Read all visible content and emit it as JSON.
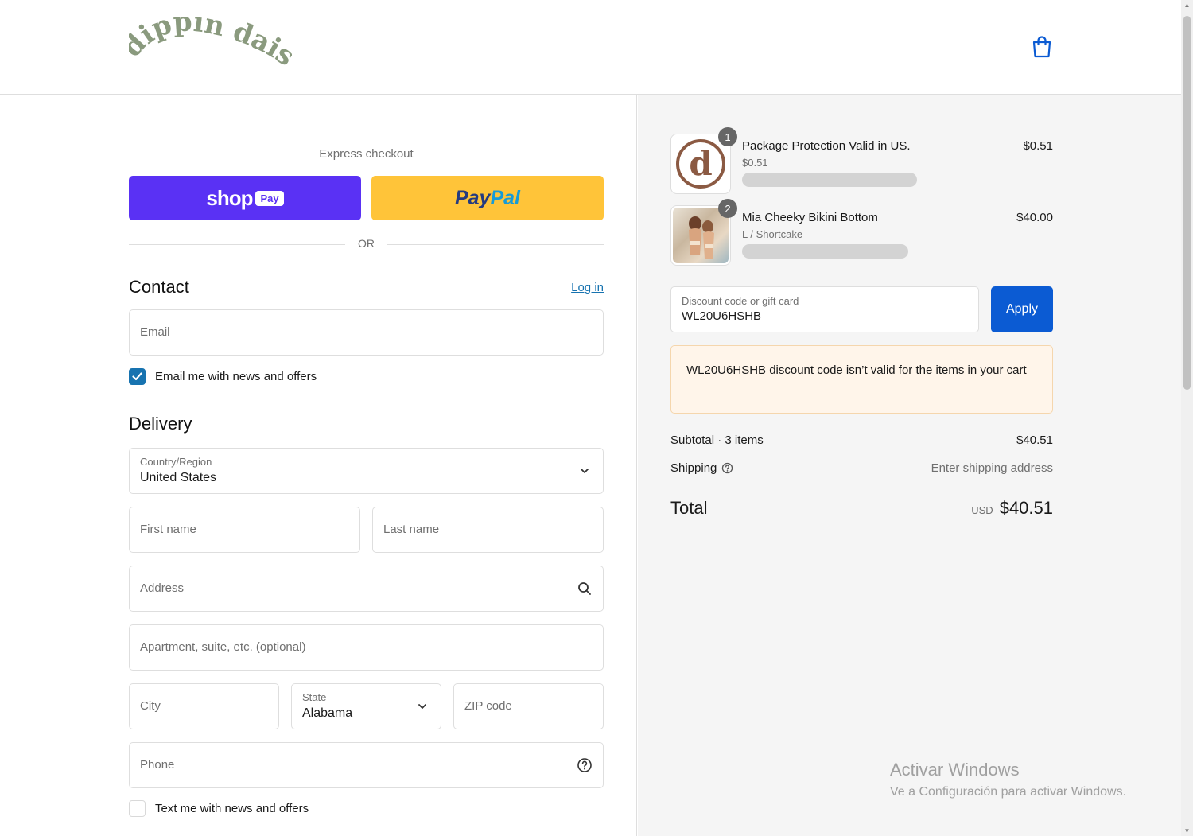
{
  "brand": {
    "logo_text": "dippin daisys"
  },
  "express": {
    "label": "Express checkout",
    "shop_word": "shop",
    "shop_badge": "Pay",
    "paypal_part1": "Pay",
    "paypal_part2": "Pal",
    "or_text": "OR"
  },
  "contact": {
    "title": "Contact",
    "login_link": "Log in",
    "email_placeholder": "Email",
    "newsletter_label": "Email me with news and offers",
    "newsletter_checked": true
  },
  "delivery": {
    "title": "Delivery",
    "country_label": "Country/Region",
    "country_value": "United States",
    "first_name_placeholder": "First name",
    "last_name_placeholder": "Last name",
    "address_placeholder": "Address",
    "apartment_placeholder": "Apartment, suite, etc. (optional)",
    "city_placeholder": "City",
    "state_label": "State",
    "state_value": "Alabama",
    "zip_placeholder": "ZIP code",
    "phone_placeholder": "Phone",
    "sms_label": "Text me with news and offers",
    "sms_checked": false
  },
  "cart": {
    "items": [
      {
        "qty": "1",
        "name": "Package Protection Valid in US.",
        "sub": "$0.51",
        "price": "$0.51",
        "thumb": "d"
      },
      {
        "qty": "2",
        "name": "Mia Cheeky Bikini Bottom",
        "sub": "L / Shortcake",
        "price": "$40.00"
      }
    ],
    "discount_label": "Discount code or gift card",
    "discount_value": "WL20U6HSHB",
    "apply_label": "Apply",
    "alert_text": "WL20U6HSHB discount code isn’t valid for the items in your cart",
    "subtotal_label": "Subtotal · 3 items",
    "subtotal_value": "$40.51",
    "shipping_label": "Shipping",
    "shipping_value": "Enter shipping address",
    "total_label": "Total",
    "currency": "USD",
    "total_value": "$40.51"
  },
  "watermark": {
    "line1": "Activar Windows",
    "line2": "Ve a Configuración para activar Windows."
  },
  "colors": {
    "shop_pay": "#5a31f4",
    "paypal": "#ffc439",
    "accent_blue": "#1773b0",
    "apply_blue": "#0b5bd3",
    "alert_bg": "#fff5ea",
    "logo_green": "#8a9a7e"
  }
}
